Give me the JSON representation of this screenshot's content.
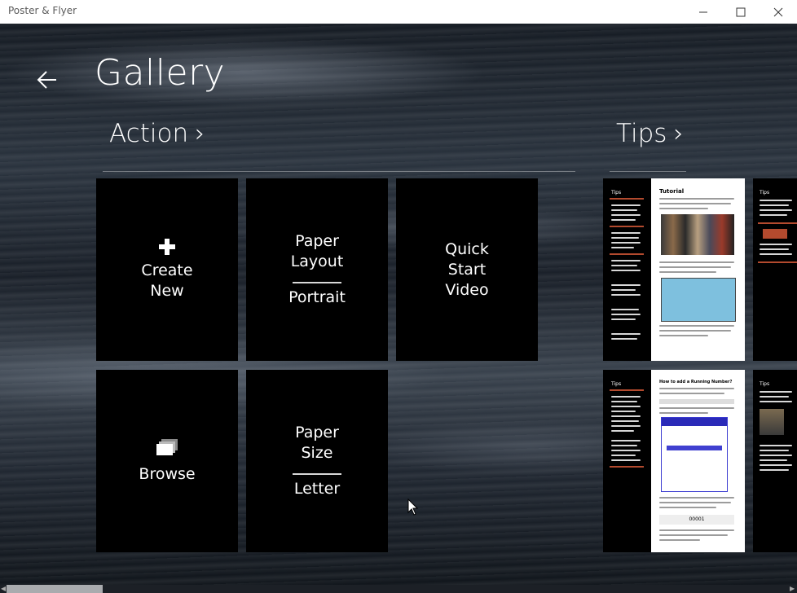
{
  "window": {
    "title": "Poster & Flyer",
    "minimize_icon": "minimize-icon",
    "maximize_icon": "maximize-icon",
    "close_icon": "close-icon"
  },
  "page": {
    "title": "Gallery",
    "back_icon": "back-arrow-icon"
  },
  "sections": {
    "action": {
      "label": "Action",
      "chevron": "›"
    },
    "tips": {
      "label": "Tips",
      "chevron": "›"
    }
  },
  "tiles": {
    "create_new": {
      "line1": "Create",
      "line2": "New",
      "icon": "plus-icon"
    },
    "paper_layout": {
      "line1": "Paper",
      "line2": "Layout",
      "value": "Portrait"
    },
    "quick_start": {
      "line1": "Quick",
      "line2": "Start",
      "line3": "Video"
    },
    "browse": {
      "label": "Browse",
      "icon": "stack-icon"
    },
    "paper_size": {
      "line1": "Paper",
      "line2": "Size",
      "value": "Letter"
    }
  },
  "tips": {
    "card1": {
      "left_head": "Tips",
      "main_head": "Tutorial",
      "right_head": "Tips"
    },
    "card2": {
      "left_head": "Tips",
      "main_head": "How to add a Running Number?",
      "right_head": "Tips",
      "number": "00001"
    }
  },
  "colors": {
    "accent": "#b34a2e",
    "tile_bg": "#000000",
    "titlebar_bg": "#ffffff"
  }
}
